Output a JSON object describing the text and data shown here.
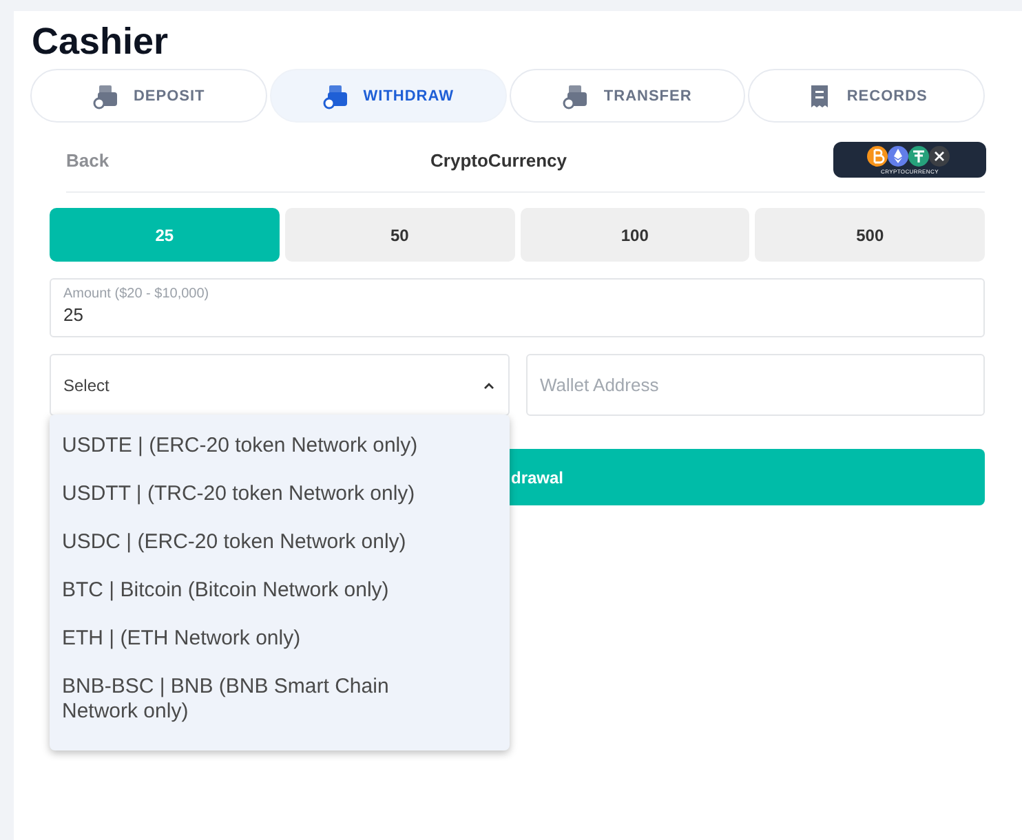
{
  "title": "Cashier",
  "tabs": [
    {
      "label": "DEPOSIT",
      "kind": "wallet",
      "selected": false
    },
    {
      "label": "WITHDRAW",
      "kind": "wallet",
      "selected": true
    },
    {
      "label": "TRANSFER",
      "kind": "wallet",
      "selected": false
    },
    {
      "label": "RECORDS",
      "kind": "receipt",
      "selected": false
    }
  ],
  "back": "Back",
  "method_title": "CryptoCurrency",
  "logo_caption": "CRYPTOCURRENCY",
  "amounts": [
    {
      "label": "25",
      "selected": true
    },
    {
      "label": "50",
      "selected": false
    },
    {
      "label": "100",
      "selected": false
    },
    {
      "label": "500",
      "selected": false
    }
  ],
  "amount_field": {
    "label": "Amount ($20 - $10,000)",
    "value": "25"
  },
  "currency_select": {
    "value": "Select",
    "expanded": true,
    "options": [
      "USDTE | (ERC-20 token Network only)",
      "USDTT | (TRC-20 token Network only)",
      "USDC | (ERC-20 token Network only)",
      "BTC | Bitcoin (Bitcoin Network only)",
      "ETH | (ETH Network only)",
      "BNB-BSC | BNB (BNB Smart Chain Network only)"
    ]
  },
  "wallet_field": {
    "placeholder": "Wallet Address"
  },
  "submit_button": "drawal"
}
